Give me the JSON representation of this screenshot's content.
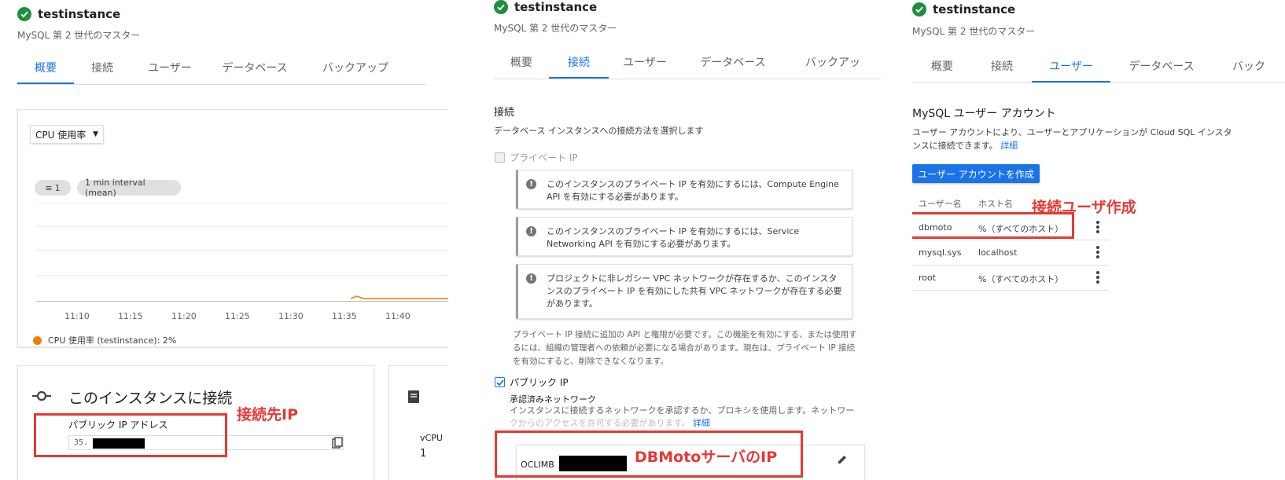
{
  "panel1": {
    "instance_name": "testinstance",
    "instance_sub": "MySQL 第 2 世代のマスター",
    "tabs": [
      "概要",
      "接続",
      "ユーザー",
      "データベース",
      "バックアップ"
    ],
    "active_tab": 0,
    "metric_dropdown": "CPU 使用率",
    "filter_chip": "1",
    "interval_chip": "1 min interval (mean)",
    "chart_data": {
      "type": "line",
      "x": [
        "11:10",
        "11:15",
        "11:20",
        "11:25",
        "11:30",
        "11:35",
        "11:40"
      ],
      "series": [
        {
          "name": "CPU 使用率 (testinstance): 2%",
          "color": "#f57c00"
        }
      ],
      "grid": true,
      "legend": "bottom-left"
    },
    "connect_title": "このインスタンスに接続",
    "public_ip_label": "パブリック IP アドレス",
    "ip_prefix": "35.",
    "annotation": "接続先IP",
    "side_label": "vCPU",
    "side_value": "1"
  },
  "panel2": {
    "instance_name": "testinstance",
    "instance_sub": "MySQL 第 2 世代のマスター",
    "tabs": [
      "概要",
      "接続",
      "ユーザー",
      "データベース",
      "バックアッ"
    ],
    "active_tab": 1,
    "section_title": "接続",
    "section_desc": "データベース インスタンスへの接続方法を選択します",
    "private_ip_label": "プライベート IP",
    "info1": "このインスタンスのプライベート IP を有効にするには、Compute Engine API を有効にする必要があります。",
    "info2": "このインスタンスのプライベート IP を有効にするには、Service Networking API を有効にする必要があります。",
    "info3": "プロジェクトに非レガシー VPC ネットワークが存在するか、このインスタンスのプライベート IP を有効にした共有 VPC ネットワークが存在する必要があります。",
    "private_note": "プライベート IP 接続に追加の API と権限が必要です。この機能を有効にする、または使用するには、組織の管理者への依頼が必要になる場合があります。現在は、プライベート IP 接続を有効にすると、削除できなくなります。",
    "public_ip_label": "パブリック IP",
    "approved_title": "承認済みネットワーク",
    "approved_desc": "インスタンスに接続するネットワークを承認するか、プロキシを使用します。ネットワー",
    "approved_desc2": "クからのアクセスを許可する必要があります。",
    "detail_link": "詳細",
    "network_name": "OCLIMB",
    "annotation": "DBMotoサーバのIP"
  },
  "panel3": {
    "instance_name": "testinstance",
    "instance_sub": "MySQL 第 2 世代のマスター",
    "tabs": [
      "概要",
      "接続",
      "ユーザー",
      "データベース",
      "バック"
    ],
    "active_tab": 2,
    "section_title": "MySQL ユーザー アカウント",
    "section_desc1": "ユーザー アカウントにより、ユーザーとアプリケーションが Cloud SQL インスタ",
    "section_desc2": "ンスに接続できます。",
    "detail_link": "詳細",
    "create_button": "ユーザー アカウントを作成",
    "col_user": "ユーザー名",
    "col_host": "ホスト名",
    "annotation": "接続ユーザ作成",
    "users": [
      {
        "name": "dbmoto",
        "host": "%（すべてのホスト）"
      },
      {
        "name": "mysql.sys",
        "host": "localhost"
      },
      {
        "name": "root",
        "host": "%（すべてのホスト）"
      }
    ]
  }
}
